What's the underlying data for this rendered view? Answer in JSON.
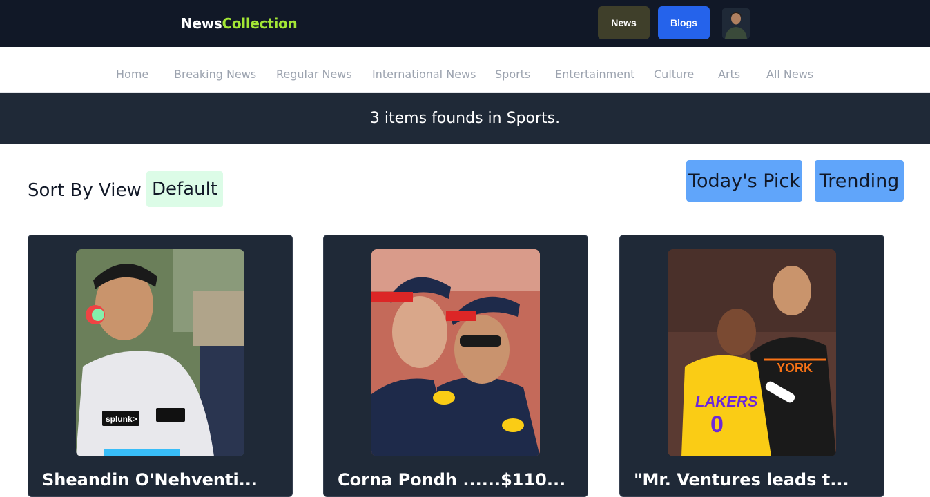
{
  "header": {
    "brand_primary": "News",
    "brand_accent": "Collection",
    "news_button": "News",
    "blogs_button": "Blogs"
  },
  "nav": {
    "items": [
      "Home",
      "Breaking News",
      "Regular News",
      "International News",
      "Sports",
      "Entertainment",
      "Culture",
      "Arts",
      "All News"
    ]
  },
  "banner": {
    "text": "3 items founds in Sports."
  },
  "sort": {
    "label": "Sort By View :",
    "value": "Default"
  },
  "actions": {
    "todays_pick": "Today's Pick",
    "trending": "Trending"
  },
  "cards": [
    {
      "title": "Sheandin O'Nehventi...",
      "image": "f1-driver-headphones-photo"
    },
    {
      "title": "Corna Pondh ......$110...",
      "image": "two-f1-drivers-photo"
    },
    {
      "title": "\"Mr. Ventures leads t...",
      "image": "basketball-players-photo"
    }
  ],
  "colors": {
    "topbar": "#111827",
    "brand_accent": "#a3e635",
    "news_button": "#3f3f2a",
    "blogs_button": "#2563eb",
    "banner": "#1f2937",
    "sort_value_bg": "#dcfce7",
    "action_button": "#60a5fa",
    "card_bg": "#1f2937"
  }
}
